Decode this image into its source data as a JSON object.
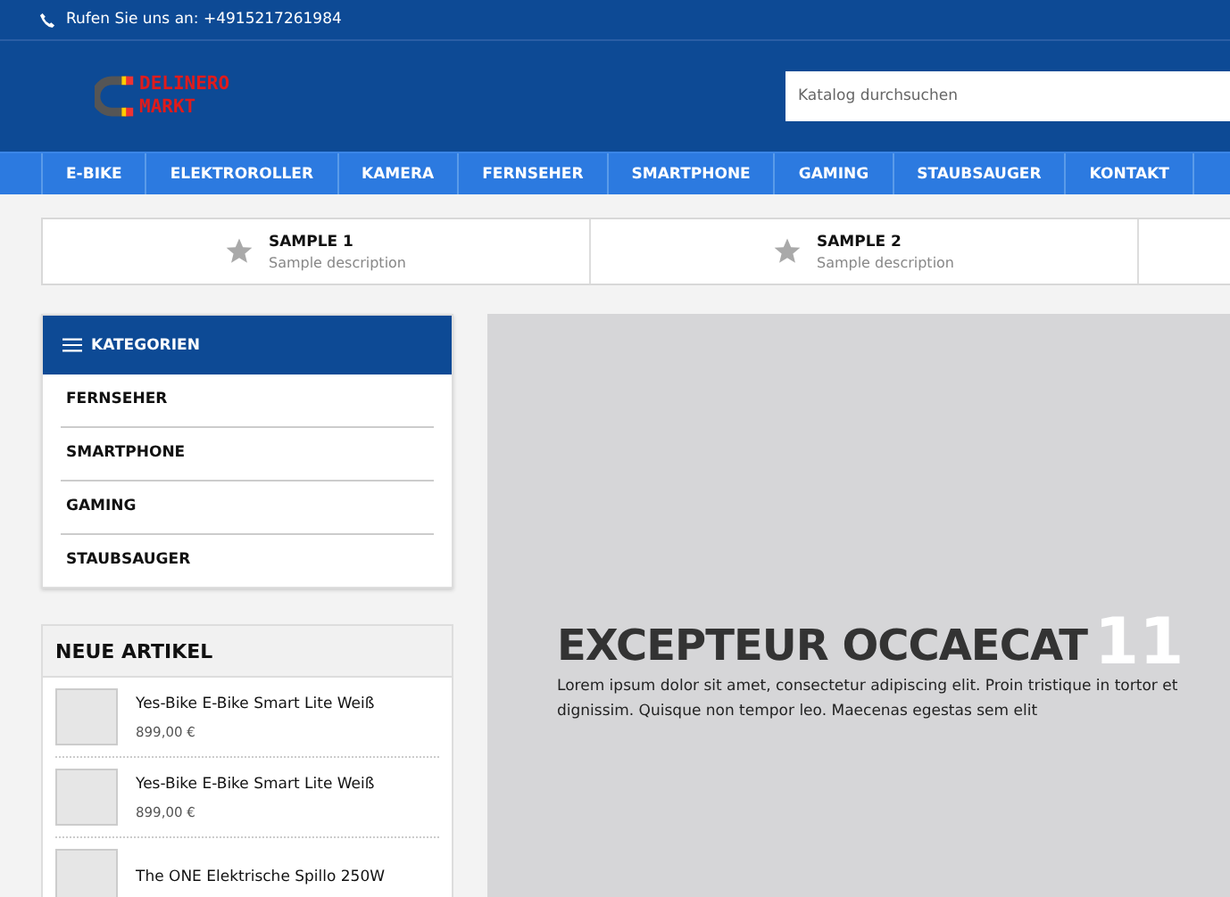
{
  "topbar": {
    "phone_text": "Rufen Sie uns an: +4915217261984"
  },
  "header": {
    "logo_lines": [
      "DELINERO",
      "MARKT"
    ],
    "search": {
      "placeholder": "Katalog durchsuchen"
    }
  },
  "nav": {
    "items": [
      {
        "label": "E-BIKE"
      },
      {
        "label": "ELEKTROROLLER"
      },
      {
        "label": "KAMERA"
      },
      {
        "label": "FERNSEHER"
      },
      {
        "label": "SMARTPHONE"
      },
      {
        "label": "GAMING"
      },
      {
        "label": "STAUBSAUGER"
      },
      {
        "label": "KONTAKT"
      }
    ]
  },
  "features": [
    {
      "title": "SAMPLE 1",
      "description": "Sample description"
    },
    {
      "title": "SAMPLE 2",
      "description": "Sample description"
    }
  ],
  "categories": {
    "title": "KATEGORIEN",
    "items": [
      "FERNSEHER",
      "SMARTPHONE",
      "GAMING",
      "STAUBSAUGER"
    ]
  },
  "new_products": {
    "title": "NEUE ARTIKEL",
    "items": [
      {
        "name": "Yes-Bike E-Bike Smart Lite Weiß",
        "price": "899,00 €"
      },
      {
        "name": "Yes-Bike E-Bike Smart Lite Weiß",
        "price": "899,00 €"
      },
      {
        "name": "The ONE Elektrische Spillo 250W"
      }
    ]
  },
  "slider": {
    "title": "EXCEPTEUR OCCAECAT",
    "number": "11",
    "text": "Lorem ipsum dolor sit amet, consectetur adipiscing elit. Proin tristique in tortor et dignissim. Quisque non tempor leo. Maecenas egestas sem elit"
  }
}
